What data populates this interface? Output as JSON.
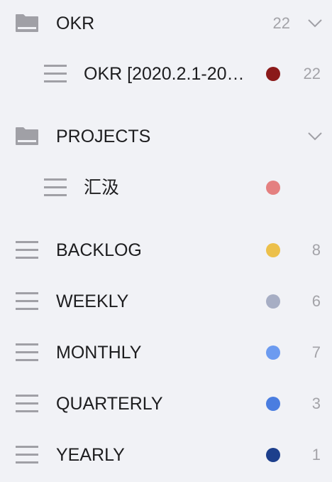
{
  "folders": [
    {
      "label": "OKR",
      "count": "22",
      "lists": [
        {
          "label": "OKR [2020.2.1-20…",
          "count": "22",
          "color": "#8b1a1a"
        }
      ]
    },
    {
      "label": "PROJECTS",
      "count": "",
      "lists": [
        {
          "label": "汇汲",
          "count": "",
          "color": "#e48080"
        }
      ]
    }
  ],
  "lists": [
    {
      "label": "BACKLOG",
      "count": "8",
      "color": "#ecc04b"
    },
    {
      "label": "WEEKLY",
      "count": "6",
      "color": "#a7aec4"
    },
    {
      "label": "MONTHLY",
      "count": "7",
      "color": "#6c9bf0"
    },
    {
      "label": "QUARTERLY",
      "count": "3",
      "color": "#4a7de0"
    },
    {
      "label": "YEARLY",
      "count": "1",
      "color": "#1d3f8c"
    }
  ]
}
